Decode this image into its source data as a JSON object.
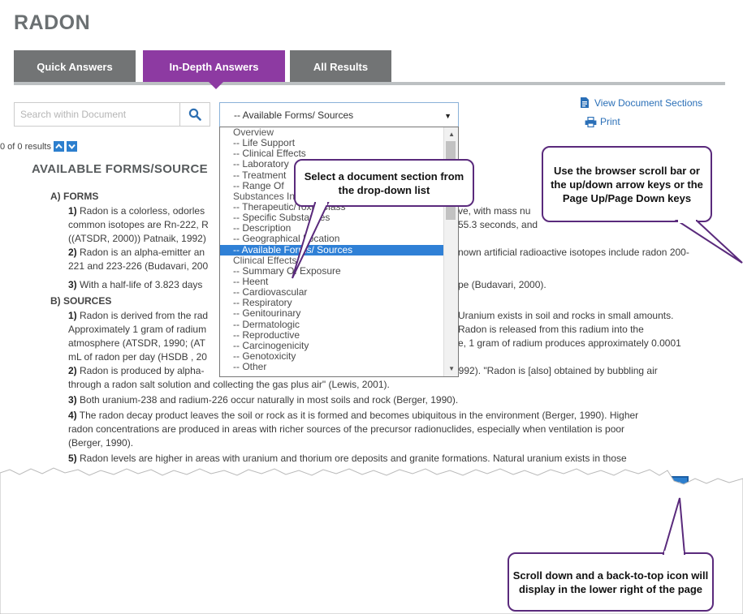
{
  "page_title": "RADON",
  "tabs": [
    {
      "label": "Quick Answers"
    },
    {
      "label": "In-Depth Answers"
    },
    {
      "label": "All Results"
    }
  ],
  "search": {
    "placeholder": "Search within Document"
  },
  "section_select": {
    "value": "-- Available Forms/ Sources"
  },
  "links": {
    "view_sections": "View Document Sections",
    "print": "Print"
  },
  "results": {
    "count_text": "0 of 0 results"
  },
  "section_heading": "AVAILABLE FORMS/SOURCE",
  "forms": {
    "heading": "A) FORMS",
    "p1_num": "1)",
    "p1_line1": "Radon is a colorless, odorles",
    "p1_line1_right": "ve, with mass nu",
    "p1_line2": "common isotopes are Rn-222, R",
    "p1_line2_right": "55.3 seconds, and",
    "p1_line3": "((ATSDR, 2000)) Patnaik, 1992)",
    "p2_num": "2)",
    "p2_line1": "Radon is an alpha-emitter an",
    "p2_line1_right": "nown artificial radioactive isotopes include radon 200-",
    "p2_line2": "221 and 223-226 (Budavari, 200",
    "p3_num": "3)",
    "p3_line1": "With a half-life of 3.823 days",
    "p3_line1_right": "pe (Budavari, 2000)."
  },
  "sources": {
    "heading": "B) SOURCES",
    "p1_num": "1)",
    "p1_line1": "Radon is derived from the rad",
    "p1_line1_right": "Uranium exists in soil and rocks in small amounts.",
    "p1_line2": "Approximately 1 gram of radium",
    "p1_line2_right": "Radon is released from this radium into the",
    "p1_line3": "atmosphere (ATSDR, 1990; (AT",
    "p1_line3_right": "e, 1 gram of radium produces approximately 0.0001",
    "p1_line4": "mL of radon per day (HSDB , 20",
    "p2_num": "2)",
    "p2_line1": "Radon is produced by alpha-",
    "p2_line1_right": "1992). \"Radon is [also] obtained by bubbling air",
    "p2_line2": "through a radon salt solution and collecting the gas plus air\" (Lewis, 2001).",
    "p3_num": "3)",
    "p3_line1": "Both uranium-238 and radium-226 occur naturally in most soils and rock (Berger, 1990).",
    "p4_num": "4)",
    "p4_line1": "The radon decay product leaves the soil or rock as it is formed and becomes ubiquitous in the environment (Berger, 1990). Higher",
    "p4_line2": "radon concentrations are produced in areas with richer sources of the precursor radionuclides, especially when ventilation is poor",
    "p4_line3": "(Berger, 1990).",
    "p5_num": "5)",
    "p5_line1": "Radon levels are higher in areas with uranium and thorium ore deposits and granite formations. Natural uranium exists in those"
  },
  "dropdown_items": [
    {
      "label": "Overview",
      "kind": "group"
    },
    {
      "label": "-- Life Support",
      "kind": "item"
    },
    {
      "label": "-- Clinical Effects",
      "kind": "item"
    },
    {
      "label": "-- Laboratory",
      "kind": "item"
    },
    {
      "label": "-- Treatment",
      "kind": "item"
    },
    {
      "label": "-- Range Of",
      "kind": "item"
    },
    {
      "label": "Substances Included/Synonyms",
      "kind": "group"
    },
    {
      "label": "-- Therapeutic/Toxic Class",
      "kind": "item"
    },
    {
      "label": "-- Specific Substances",
      "kind": "item"
    },
    {
      "label": "-- Description",
      "kind": "item"
    },
    {
      "label": "-- Geographical Location",
      "kind": "item"
    },
    {
      "label": "-- Available Forms/ Sources",
      "kind": "selected"
    },
    {
      "label": "Clinical Effects",
      "kind": "group"
    },
    {
      "label": "-- Summary Of Exposure",
      "kind": "item"
    },
    {
      "label": "-- Heent",
      "kind": "item"
    },
    {
      "label": "-- Cardiovascular",
      "kind": "item"
    },
    {
      "label": "-- Respiratory",
      "kind": "item"
    },
    {
      "label": "-- Genitourinary",
      "kind": "item"
    },
    {
      "label": "-- Dermatologic",
      "kind": "item"
    },
    {
      "label": "-- Reproductive",
      "kind": "item"
    },
    {
      "label": "-- Carcinogenicity",
      "kind": "item"
    },
    {
      "label": "-- Genotoxicity",
      "kind": "item"
    },
    {
      "label": "-- Other",
      "kind": "item"
    }
  ],
  "callouts": {
    "select_section": "Select a document section from the drop-down list",
    "scroll": "Use the browser scroll bar or the up/down arrow keys or the Page Up/Page Down keys",
    "back_to_top": "Scroll down and a back-to-top icon will display in the lower right of the page"
  },
  "colors": {
    "active_tab": "#8d3aa2",
    "inactive_tab": "#727475",
    "link": "#2a6fb7",
    "accent_blue": "#2d7fce",
    "callout_border": "#5a2a7c",
    "selected_item": "#2f80d6"
  }
}
